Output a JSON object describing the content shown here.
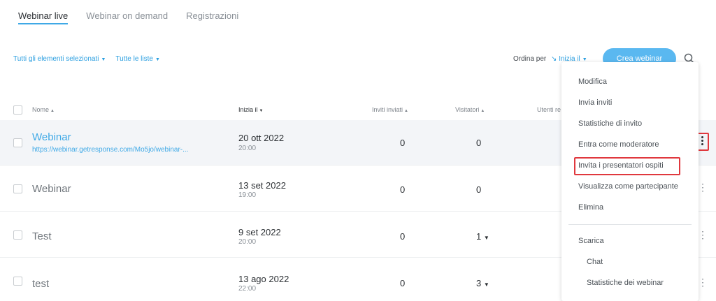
{
  "tabs": [
    {
      "label": "Webinar live",
      "active": true
    },
    {
      "label": "Webinar on demand",
      "active": false
    },
    {
      "label": "Registrazioni",
      "active": false
    }
  ],
  "filters": {
    "selection": "Tutti gli elementi selezionati",
    "lists": "Tutte le liste"
  },
  "sort": {
    "label": "Ordina per",
    "value": "Inizia il"
  },
  "create_button": "Crea webinar",
  "table": {
    "columns": {
      "name": "Nome",
      "start": "Inizia il",
      "invites": "Inviti inviati",
      "visitors": "Visitatori",
      "users": "Utenti re"
    },
    "rows": [
      {
        "name": "Webinar",
        "url": "https://webinar.getresponse.com/Mo5jo/webinar-...",
        "date": "20 ott 2022",
        "time": "20:00",
        "invites": "0",
        "visitors": "0"
      },
      {
        "name": "Webinar",
        "url": "",
        "date": "13 set 2022",
        "time": "19:00",
        "invites": "0",
        "visitors": "0"
      },
      {
        "name": "Test",
        "url": "",
        "date": "9 set 2022",
        "time": "20:00",
        "invites": "0",
        "visitors": "1"
      },
      {
        "name": "test",
        "url": "",
        "date": "13 ago 2022",
        "time": "22:00",
        "invites": "0",
        "visitors": "3"
      }
    ]
  },
  "menu": {
    "items": [
      "Modifica",
      "Invia inviti",
      "Statistiche di invito",
      "Entra come moderatore",
      "Invita i presentatori ospiti",
      "Visualizza come partecipante",
      "Elimina"
    ],
    "download_label": "Scarica",
    "download_items": [
      "Chat",
      "Statistiche dei webinar"
    ]
  },
  "colors": {
    "accent": "#3fa9e6",
    "button": "#5ab8f0",
    "highlight_border": "#e0383e"
  }
}
